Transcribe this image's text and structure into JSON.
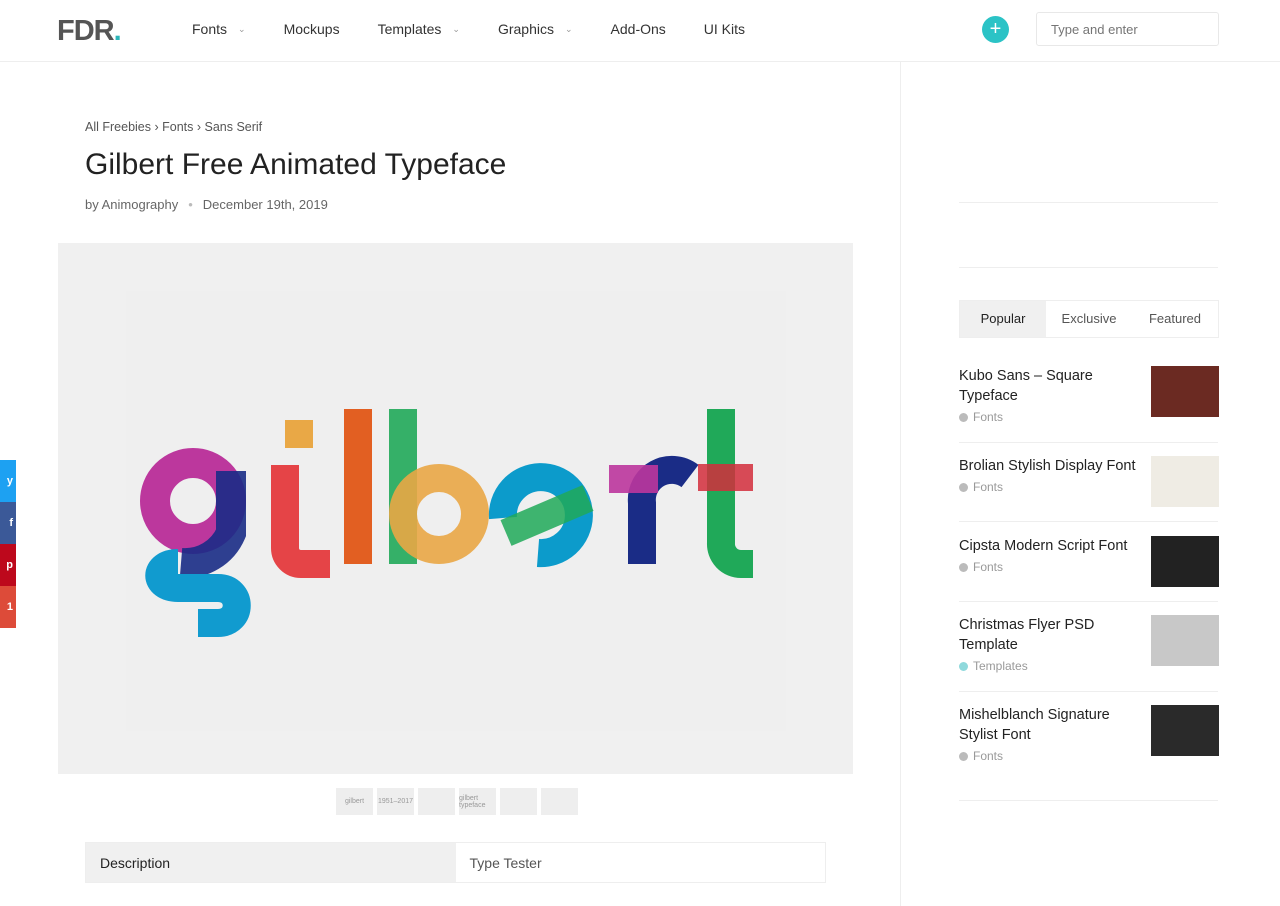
{
  "header": {
    "logo": "FDR",
    "logo_dot": ".",
    "nav": [
      {
        "label": "Fonts",
        "dropdown": true
      },
      {
        "label": "Mockups",
        "dropdown": false
      },
      {
        "label": "Templates",
        "dropdown": true
      },
      {
        "label": "Graphics",
        "dropdown": true
      },
      {
        "label": "Add-Ons",
        "dropdown": false
      },
      {
        "label": "UI Kits",
        "dropdown": false
      }
    ],
    "plus": "+",
    "search_placeholder": "Type and enter",
    "accent": "#2bc3c6"
  },
  "breadcrumb": "All Freebies › Fonts › Sans Serif",
  "title": "Gilbert Free Animated Typeface",
  "author": "by Animography",
  "date": "December 19th, 2019",
  "hero_lettering": "gilbert",
  "thumbnails": [
    "gilbert",
    "1951–2017",
    "",
    "gilbert typeface",
    "",
    ""
  ],
  "content_tabs": [
    "Description",
    "Type Tester"
  ],
  "share": [
    {
      "icon": "twitter-icon",
      "color": "#1da1f2"
    },
    {
      "icon": "facebook-icon",
      "color": "#3b5998"
    },
    {
      "icon": "pinterest-icon",
      "color": "#bd081c"
    },
    {
      "icon": "plus-icon",
      "color": "#dd4b39",
      "label": "1"
    }
  ],
  "sidebar": {
    "tabs": [
      "Popular",
      "Exclusive",
      "Featured"
    ],
    "posts": [
      {
        "title": "Kubo Sans – Square Typeface",
        "category": "Fonts",
        "thumb": "#6b2a22",
        "dot": "#bbbbbb"
      },
      {
        "title": "Brolian Stylish Display Font",
        "category": "Fonts",
        "thumb": "#efece4",
        "dot": "#bbbbbb"
      },
      {
        "title": "Cipsta Modern Script Font",
        "category": "Fonts",
        "thumb": "#222222",
        "dot": "#bbbbbb"
      },
      {
        "title": "Christmas Flyer PSD Template",
        "category": "Templates",
        "thumb": "#c8c8c8",
        "dot": "#8fd9dc"
      },
      {
        "title": "Mishelblanch Signature Stylist Font",
        "category": "Fonts",
        "thumb": "#2a2a2a",
        "dot": "#bbbbbb"
      }
    ]
  }
}
